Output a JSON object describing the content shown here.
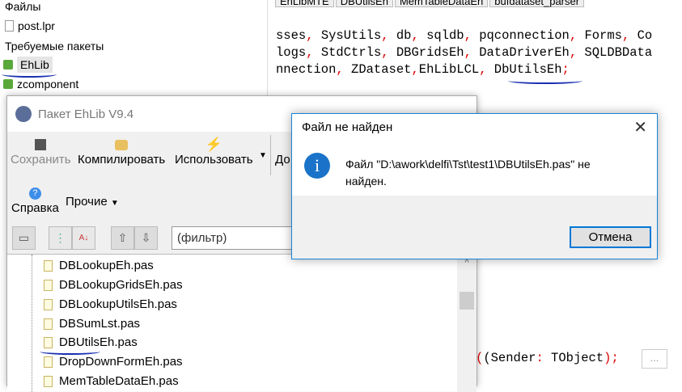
{
  "left_panel": {
    "files_label": "Файлы",
    "file": "post.lpr",
    "required_label": "Требуемые пакеты",
    "packages": [
      "EhLib",
      "zcomponent"
    ]
  },
  "editor": {
    "tabs": [
      "EhLibMTE",
      "DBUtilsEh",
      "MemTableDataEh",
      "bufdataset_parser"
    ],
    "line1": [
      "sses",
      ", ",
      "SysUtils",
      ", ",
      "db",
      ", ",
      "sqldb",
      ", ",
      "pqconnection",
      ", ",
      "Forms",
      ", ",
      "Co"
    ],
    "line2": [
      "logs",
      ", ",
      "StdCtrls",
      ", ",
      "DBGridsEh",
      ", ",
      "DataDriverEh",
      ", ",
      "SQLDBData"
    ],
    "line3": [
      "nnection",
      ", ",
      "ZDataset",
      ",",
      "EhLibLCL",
      ", ",
      "DbUtilsEh",
      ";"
    ],
    "line4": [
      "(Sender",
      ": ",
      "TObject",
      ");"
    ],
    "ellipsis": "..."
  },
  "package_window": {
    "title": "Пакет EhLib V9.4",
    "toolbar": {
      "save": "Сохранить",
      "compile": "Компилировать",
      "use": "Использовать",
      "add": "До",
      "help": "Справка",
      "more": "Прочие"
    },
    "filter_placeholder": "(фильтр)",
    "files": [
      "DBLookupEh.pas",
      "DBLookupGridsEh.pas",
      "DBLookupUtilsEh.pas",
      "DBSumLst.pas",
      "DBUtilsEh.pas",
      "DropDownFormEh.pas",
      "MemTableDataEh.pas"
    ]
  },
  "dialog": {
    "title": "Файл не найден",
    "message": "Файл \"D:\\awork\\delfi\\Tst\\test1\\DBUtilsEh.pas\" не найден.",
    "cancel": "Отмена"
  }
}
